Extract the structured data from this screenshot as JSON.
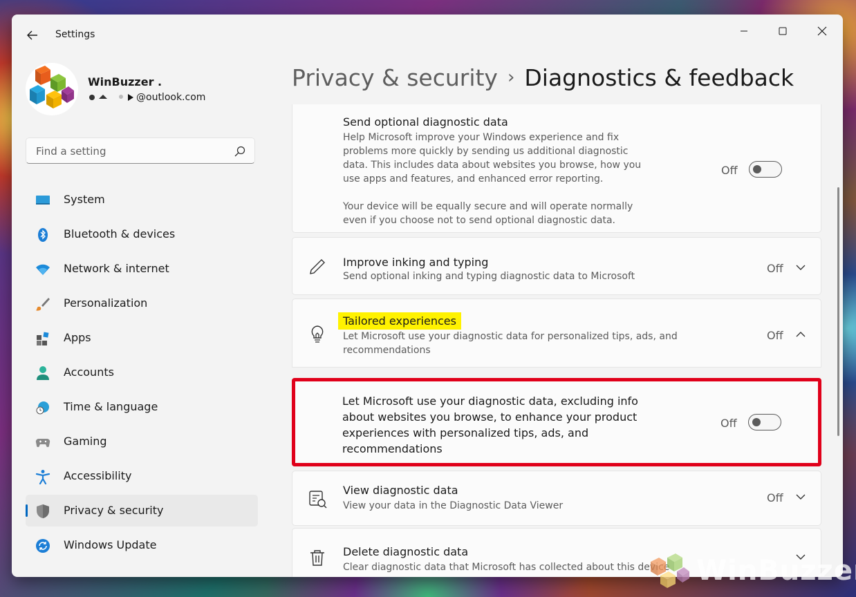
{
  "window": {
    "title": "Settings"
  },
  "profile": {
    "name": "WinBuzzer .",
    "email": "@outlook.com"
  },
  "search": {
    "placeholder": "Find a setting"
  },
  "sidebar": {
    "items": [
      {
        "label": "System",
        "icon": "monitor-icon"
      },
      {
        "label": "Bluetooth & devices",
        "icon": "bluetooth-icon"
      },
      {
        "label": "Network & internet",
        "icon": "wifi-icon"
      },
      {
        "label": "Personalization",
        "icon": "brush-icon"
      },
      {
        "label": "Apps",
        "icon": "apps-icon"
      },
      {
        "label": "Accounts",
        "icon": "person-icon"
      },
      {
        "label": "Time & language",
        "icon": "globe-clock-icon"
      },
      {
        "label": "Gaming",
        "icon": "gamepad-icon"
      },
      {
        "label": "Accessibility",
        "icon": "accessibility-icon"
      },
      {
        "label": "Privacy & security",
        "icon": "shield-icon",
        "active": true
      },
      {
        "label": "Windows Update",
        "icon": "update-icon"
      }
    ]
  },
  "breadcrumb": {
    "parent": "Privacy & security",
    "separator": "›",
    "current": "Diagnostics & feedback"
  },
  "settings": {
    "optional_data": {
      "title": "Send optional diagnostic data",
      "desc_lines": [
        "Help Microsoft improve your Windows experience and fix",
        "problems more quickly by sending us additional diagnostic",
        "data. This includes data about websites you browse, how you",
        "use apps and features, and enhanced error reporting."
      ],
      "note_lines": [
        "Your device will be equally secure and will operate normally",
        "even if you choose not to send optional diagnostic data."
      ],
      "state": "Off"
    },
    "inking": {
      "title": "Improve inking and typing",
      "desc": "Send optional inking and typing diagnostic data to Microsoft",
      "state": "Off"
    },
    "tailored": {
      "title": "Tailored experiences",
      "desc_lines": [
        "Let Microsoft use your diagnostic data for personalized tips, ads, and",
        "recommendations"
      ],
      "state": "Off",
      "sub": {
        "lines": [
          "Let Microsoft use your diagnostic data, excluding info",
          "about websites you browse, to enhance your product",
          "experiences with personalized tips, ads, and",
          "recommendations"
        ],
        "state": "Off"
      }
    },
    "view_data": {
      "title": "View diagnostic data",
      "desc": "View your data in the Diagnostic Data Viewer",
      "state": "Off"
    },
    "delete_data": {
      "title": "Delete diagnostic data",
      "desc": "Clear diagnostic data that Microsoft has collected about this device"
    }
  },
  "watermark": {
    "text": "WinBuzzer"
  },
  "colors": {
    "accent": "#0067c0",
    "highlight": "#fff200",
    "annotation_red": "#e0001a"
  }
}
